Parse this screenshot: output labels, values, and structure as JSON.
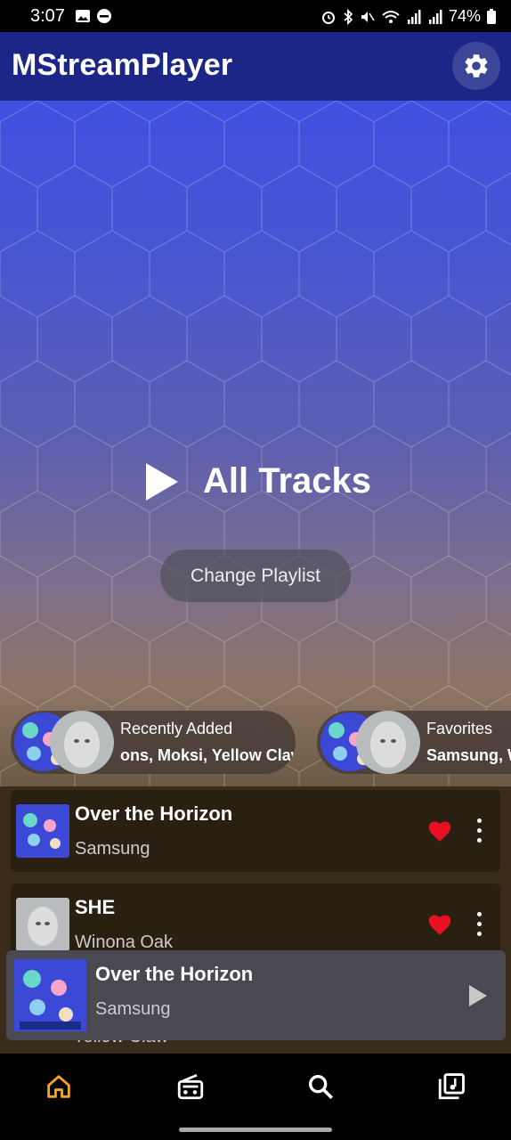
{
  "status_bar": {
    "time": "3:07",
    "battery": "74%"
  },
  "app_bar": {
    "title": "MStreamPlayer"
  },
  "hero": {
    "play_label": "All Tracks",
    "change_playlist_label": "Change Playlist"
  },
  "playlists": [
    {
      "name": "Recently Added",
      "artists": "Samsung, Winona Oak, Dimitri Vegas & Like Mike, Moksi, Yellow Claw",
      "artists_visible": "ons, Moksi, Yellow Claw"
    },
    {
      "name": "Favorites",
      "artists": "Samsung, W",
      "artists_visible": "Samsung, W"
    }
  ],
  "tracks": [
    {
      "title": "Over the Horizon",
      "artist": "Samsung",
      "favorite": true
    },
    {
      "title": "SHE",
      "artist": "Winona Oak",
      "favorite": true
    }
  ],
  "peek_artist": "Yellow Claw",
  "now_playing": {
    "title": "Over the Horizon",
    "artist": "Samsung"
  },
  "bottom_nav": [
    {
      "icon": "home-icon",
      "active": true
    },
    {
      "icon": "radio-icon",
      "active": false
    },
    {
      "icon": "search-icon",
      "active": false
    },
    {
      "icon": "library-icon",
      "active": false
    }
  ],
  "colors": {
    "accent": "#f5a623",
    "app_bar": "#1c2687",
    "heart": "#e81123"
  }
}
